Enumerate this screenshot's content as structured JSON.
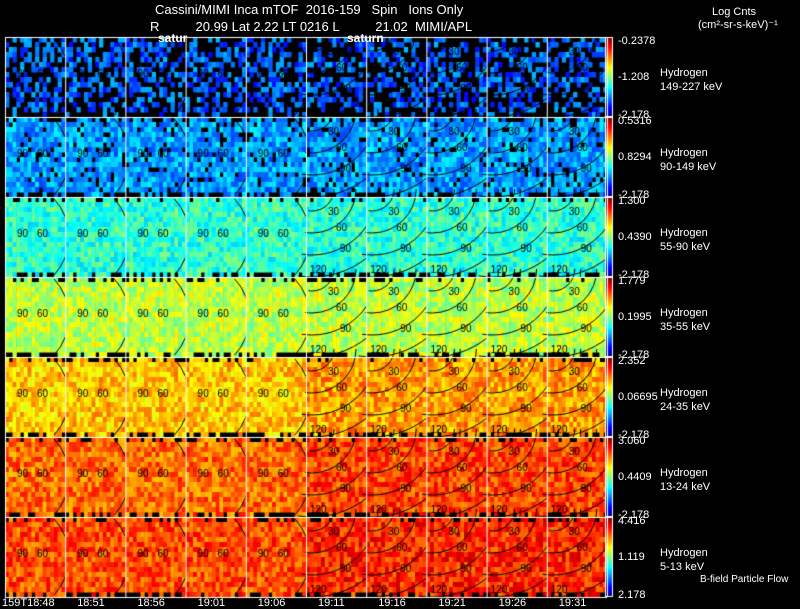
{
  "header": {
    "line1": "Cassini/MIMI Inca mTOF  2016-159   Spin   Ions Only",
    "line2": "R          20.99 Lat 2.22 LT 0216 L          21.02  MIMI/APL",
    "saturn_label_1": "satur",
    "saturn_label_2": "saturn"
  },
  "units": {
    "line1": "Log Cnts",
    "line2": "(cm²-sr-s-keV)⁻¹"
  },
  "chart_data": {
    "type": "heatmap",
    "title": "Cassini/MIMI Inca mTOF 2016-159 Spin Ions Only",
    "x_tick_labels": [
      "159T18:48",
      "18:51",
      "18:56",
      "19:01",
      "19:06",
      "19:11",
      "19:16",
      "19:21",
      "19:26",
      "19:31"
    ],
    "contour_labels": [
      "30",
      "60",
      "90",
      "120"
    ],
    "colormap": "jet",
    "rows": [
      {
        "species": "Hydrogen",
        "energy": "149-227 keV",
        "max": "-0.2378",
        "mid": "-1.208",
        "min": "-2.178",
        "level": 0.22
      },
      {
        "species": "Hydrogen",
        "energy": "90-149 keV",
        "max": "0.5316",
        "mid": "0.8294",
        "min": "-2.178",
        "level": 0.28
      },
      {
        "species": "Hydrogen",
        "energy": "55-90 keV",
        "max": "1.300",
        "mid": "0.4390",
        "min": "-2.178",
        "level": 0.42
      },
      {
        "species": "Hydrogen",
        "energy": "35-55 keV",
        "max": "1.779",
        "mid": "0.1995",
        "min": "-2.178",
        "level": 0.56
      },
      {
        "species": "Hydrogen",
        "energy": "24-35 keV",
        "max": "2.352",
        "mid": "0.06695",
        "min": "-2.178",
        "level": 0.68
      },
      {
        "species": "Hydrogen",
        "energy": "13-24 keV",
        "max": "3.060",
        "mid": "0.4409",
        "min": "-2.178",
        "level": 0.77
      },
      {
        "species": "Hydrogen",
        "energy": "5-13 keV",
        "max": "4.416",
        "mid": "1.119",
        "min": "2.178",
        "level": 0.8
      }
    ]
  },
  "footer": {
    "flow_label": "B-field Particle Flow"
  }
}
